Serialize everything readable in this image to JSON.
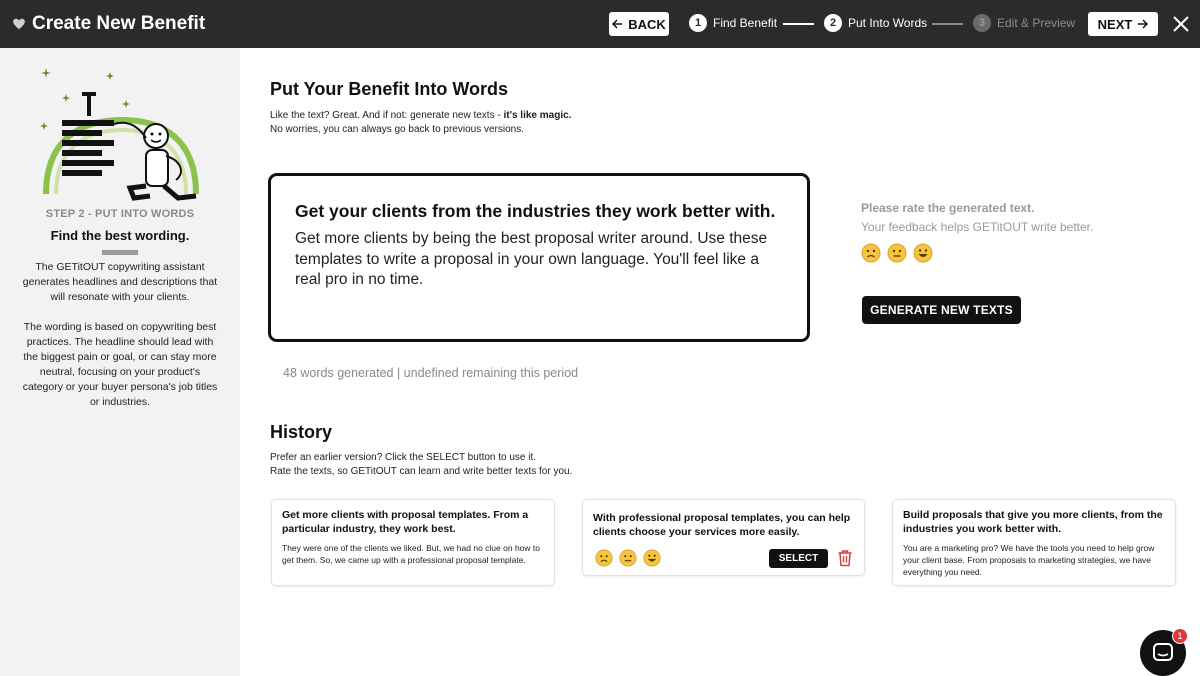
{
  "header": {
    "title": "Create New Benefit",
    "back_label": "BACK",
    "next_label": "NEXT",
    "steps": [
      {
        "num": "1",
        "label": "Find Benefit"
      },
      {
        "num": "2",
        "label": "Put Into Words"
      },
      {
        "num": "3",
        "label": "Edit & Preview"
      }
    ]
  },
  "sidebar": {
    "step_label": "STEP 2 - PUT INTO WORDS",
    "heading": "Find the best wording.",
    "para1": "The GETitOUT copywriting assistant generates headlines and descriptions that will resonate with your clients.",
    "para2": "The wording is based on copywriting best practices. The headline should lead with the biggest pain or goal, or can stay more neutral, focusing on your product's category or your buyer persona's job titles or industries."
  },
  "main": {
    "title": "Put Your Benefit Into Words",
    "intro_line1_prefix": "Like the text? Great. And if not: generate new texts - ",
    "intro_line1_bold": "it's like magic.",
    "intro_line2": "No worries, you can always go back to previous versions.",
    "generated": {
      "headline": "Get your clients from the industries they work better with.",
      "description": "Get more clients by being the best proposal writer around. Use these templates to write a proposal in your own language. You'll feel like a real pro in no time."
    },
    "word_count": "48 words generated | undefined remaining this period",
    "rating": {
      "title": "Please rate the generated text.",
      "subtitle": "Your feedback helps GETitOUT write better."
    },
    "generate_label": "GENERATE NEW TEXTS"
  },
  "history": {
    "title": "History",
    "intro_line1": "Prefer an earlier version? Click the SELECT button to use it.",
    "intro_line2": "Rate the texts, so GETitOUT can learn and write better texts for you.",
    "cards": [
      {
        "headline": "Get more clients with proposal templates. From a particular industry, they work best.",
        "description": "They were one of the clients we liked. But, we had no clue on how to get them. So, we came up with a professional proposal template."
      },
      {
        "headline": "With professional proposal templates, you can help clients choose your services more easily.",
        "description": ""
      },
      {
        "headline": "Build proposals that give you more clients, from the industries you work better with.",
        "description": "You are a marketing pro? We have the tools you need to help grow your client base. From proposals to marketing strategies, we have everything you need."
      }
    ],
    "select_label": "SELECT"
  },
  "chat": {
    "badge_count": "1"
  },
  "colors": {
    "topbar": "#2b2b2b",
    "sidebar": "#f2f2f2",
    "accent_green": "#8bc34a",
    "danger": "#d93b3b"
  }
}
